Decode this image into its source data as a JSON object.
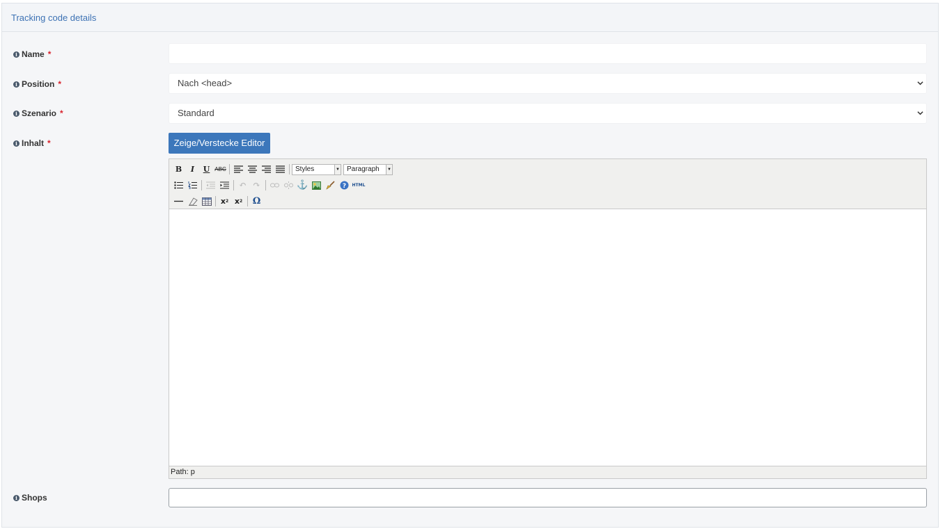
{
  "panel": {
    "title": "Tracking code details"
  },
  "fields": {
    "name": {
      "label": "Name",
      "required_mark": "*",
      "value": ""
    },
    "position": {
      "label": "Position",
      "required_mark": "*",
      "selected": "Nach <head>"
    },
    "scenario": {
      "label": "Szenario",
      "required_mark": "*",
      "selected": "Standard"
    },
    "content": {
      "label": "Inhalt",
      "required_mark": "*",
      "toggle_button": "Zeige/Verstecke Editor"
    },
    "shops": {
      "label": "Shops",
      "value": ""
    }
  },
  "editor": {
    "styles_select": "Styles",
    "format_select": "Paragraph",
    "html_button": "HTML",
    "path": "Path: p",
    "toolbar_row1": [
      "bold-icon",
      "italic-icon",
      "underline-icon",
      "strikethrough-icon",
      "align-left-icon",
      "align-center-icon",
      "align-right-icon",
      "align-justify-icon"
    ],
    "toolbar_row2": [
      "bullet-list-icon",
      "numbered-list-icon",
      "outdent-icon",
      "indent-icon",
      "undo-icon",
      "redo-icon",
      "link-icon",
      "unlink-icon",
      "anchor-icon",
      "image-icon",
      "cleanup-icon",
      "help-icon",
      "html-icon"
    ],
    "toolbar_row3": [
      "horizontal-rule-icon",
      "remove-format-icon",
      "table-icon",
      "subscript-icon",
      "superscript-icon",
      "special-char-icon"
    ]
  },
  "colors": {
    "accent": "#3c77bb",
    "required": "#d9232d",
    "heading": "#3d72b4"
  }
}
